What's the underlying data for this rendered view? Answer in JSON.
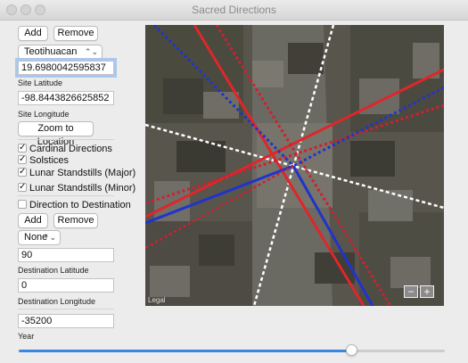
{
  "window": {
    "title": "Sacred Directions",
    "traffic_light_color": "#d3d3d3"
  },
  "toolbar": {
    "add_label": "Add",
    "remove_label": "Remove"
  },
  "site": {
    "selected": "Teotihuacan",
    "latitude_value": "19.6980042595837",
    "latitude_label": "Site Latitude",
    "longitude_value": "-98.8443826625852",
    "longitude_label": "Site Longitude",
    "zoom_button": "Zoom to Location"
  },
  "layers": [
    {
      "label": "Cardinal Directions",
      "checked": true
    },
    {
      "label": "Solstices",
      "checked": true
    },
    {
      "label": "Lunar Standstills (Major)",
      "checked": true
    },
    {
      "label": "Lunar Standstills (Minor)",
      "checked": true
    }
  ],
  "destination": {
    "toggle_label": "Direction to Destination",
    "add_label": "Add",
    "remove_label": "Remove",
    "selected": "None",
    "latitude_value": "90",
    "latitude_label": "Destination Latitude",
    "longitude_value": "0",
    "longitude_label": "Destination Longitude"
  },
  "year": {
    "value": "-35200",
    "label": "Year",
    "slider_fraction": 0.78
  },
  "map": {
    "legal_label": "Legal",
    "zoom_out": "−",
    "zoom_in": "+",
    "line_colors": {
      "solstice": "#e0262a",
      "lunar": "#2233cc",
      "cardinal": "#ffffff"
    }
  }
}
